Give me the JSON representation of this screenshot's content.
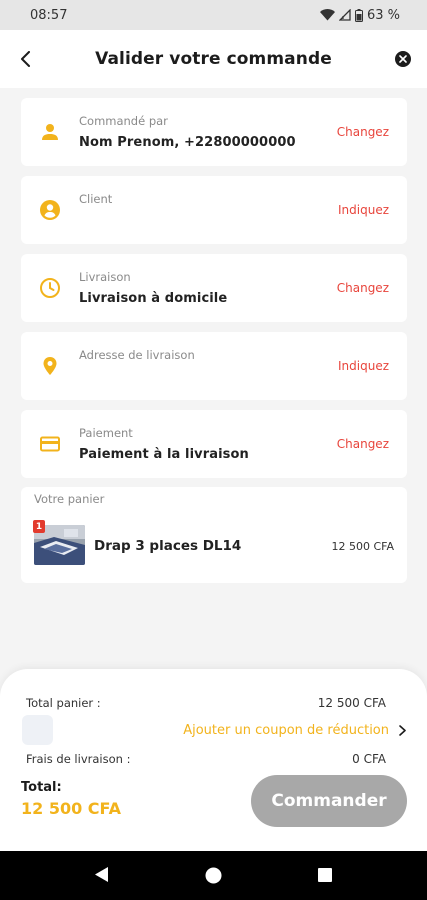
{
  "status_bar": {
    "time": "08:57",
    "battery": "63 %"
  },
  "header": {
    "title": "Valider votre commande"
  },
  "cards": [
    {
      "icon": "person-icon",
      "label": "Commandé par",
      "value": "Nom Prenom, +22800000000",
      "action": "Changez"
    },
    {
      "icon": "account-circle-icon",
      "label": "Client",
      "value": "",
      "action": "Indiquez"
    },
    {
      "icon": "clock-icon",
      "label": "Livraison",
      "value": "Livraison à domicile",
      "action": "Changez"
    },
    {
      "icon": "location-pin-icon",
      "label": "Adresse de livraison",
      "value": "",
      "action": "Indiquez"
    },
    {
      "icon": "credit-card-icon",
      "label": "Paiement",
      "value": "Paiement à la livraison",
      "action": "Changez"
    }
  ],
  "panier": {
    "title": "Votre panier",
    "item": {
      "quantity": "1",
      "name": "Drap 3 places DL14",
      "price": "12 500 CFA"
    }
  },
  "summary": {
    "total_panier_label": "Total panier :",
    "total_panier_value": "12 500 CFA",
    "coupon_label": "Ajouter un coupon de réduction",
    "frais_label": "Frais de livraison :",
    "frais_value": "0 CFA",
    "total_label": "Total:",
    "total_value": "12 500 CFA",
    "commander_label": "Commander"
  },
  "colors": {
    "accent": "#f2b31c",
    "action": "#e8453c",
    "button_disabled": "#a8a8a8"
  }
}
